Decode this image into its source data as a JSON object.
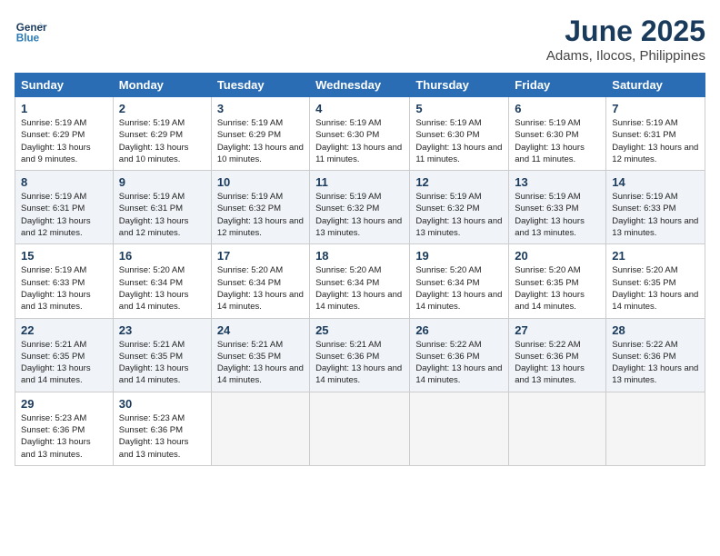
{
  "logo": {
    "line1": "General",
    "line2": "Blue"
  },
  "title": "June 2025",
  "subtitle": "Adams, Ilocos, Philippines",
  "weekdays": [
    "Sunday",
    "Monday",
    "Tuesday",
    "Wednesday",
    "Thursday",
    "Friday",
    "Saturday"
  ],
  "weeks": [
    [
      {
        "day": "1",
        "sunrise": "5:19 AM",
        "sunset": "6:29 PM",
        "daylight": "13 hours and 9 minutes."
      },
      {
        "day": "2",
        "sunrise": "5:19 AM",
        "sunset": "6:29 PM",
        "daylight": "13 hours and 10 minutes."
      },
      {
        "day": "3",
        "sunrise": "5:19 AM",
        "sunset": "6:29 PM",
        "daylight": "13 hours and 10 minutes."
      },
      {
        "day": "4",
        "sunrise": "5:19 AM",
        "sunset": "6:30 PM",
        "daylight": "13 hours and 11 minutes."
      },
      {
        "day": "5",
        "sunrise": "5:19 AM",
        "sunset": "6:30 PM",
        "daylight": "13 hours and 11 minutes."
      },
      {
        "day": "6",
        "sunrise": "5:19 AM",
        "sunset": "6:30 PM",
        "daylight": "13 hours and 11 minutes."
      },
      {
        "day": "7",
        "sunrise": "5:19 AM",
        "sunset": "6:31 PM",
        "daylight": "13 hours and 12 minutes."
      }
    ],
    [
      {
        "day": "8",
        "sunrise": "5:19 AM",
        "sunset": "6:31 PM",
        "daylight": "13 hours and 12 minutes."
      },
      {
        "day": "9",
        "sunrise": "5:19 AM",
        "sunset": "6:31 PM",
        "daylight": "13 hours and 12 minutes."
      },
      {
        "day": "10",
        "sunrise": "5:19 AM",
        "sunset": "6:32 PM",
        "daylight": "13 hours and 12 minutes."
      },
      {
        "day": "11",
        "sunrise": "5:19 AM",
        "sunset": "6:32 PM",
        "daylight": "13 hours and 13 minutes."
      },
      {
        "day": "12",
        "sunrise": "5:19 AM",
        "sunset": "6:32 PM",
        "daylight": "13 hours and 13 minutes."
      },
      {
        "day": "13",
        "sunrise": "5:19 AM",
        "sunset": "6:33 PM",
        "daylight": "13 hours and 13 minutes."
      },
      {
        "day": "14",
        "sunrise": "5:19 AM",
        "sunset": "6:33 PM",
        "daylight": "13 hours and 13 minutes."
      }
    ],
    [
      {
        "day": "15",
        "sunrise": "5:19 AM",
        "sunset": "6:33 PM",
        "daylight": "13 hours and 13 minutes."
      },
      {
        "day": "16",
        "sunrise": "5:20 AM",
        "sunset": "6:34 PM",
        "daylight": "13 hours and 14 minutes."
      },
      {
        "day": "17",
        "sunrise": "5:20 AM",
        "sunset": "6:34 PM",
        "daylight": "13 hours and 14 minutes."
      },
      {
        "day": "18",
        "sunrise": "5:20 AM",
        "sunset": "6:34 PM",
        "daylight": "13 hours and 14 minutes."
      },
      {
        "day": "19",
        "sunrise": "5:20 AM",
        "sunset": "6:34 PM",
        "daylight": "13 hours and 14 minutes."
      },
      {
        "day": "20",
        "sunrise": "5:20 AM",
        "sunset": "6:35 PM",
        "daylight": "13 hours and 14 minutes."
      },
      {
        "day": "21",
        "sunrise": "5:20 AM",
        "sunset": "6:35 PM",
        "daylight": "13 hours and 14 minutes."
      }
    ],
    [
      {
        "day": "22",
        "sunrise": "5:21 AM",
        "sunset": "6:35 PM",
        "daylight": "13 hours and 14 minutes."
      },
      {
        "day": "23",
        "sunrise": "5:21 AM",
        "sunset": "6:35 PM",
        "daylight": "13 hours and 14 minutes."
      },
      {
        "day": "24",
        "sunrise": "5:21 AM",
        "sunset": "6:35 PM",
        "daylight": "13 hours and 14 minutes."
      },
      {
        "day": "25",
        "sunrise": "5:21 AM",
        "sunset": "6:36 PM",
        "daylight": "13 hours and 14 minutes."
      },
      {
        "day": "26",
        "sunrise": "5:22 AM",
        "sunset": "6:36 PM",
        "daylight": "13 hours and 14 minutes."
      },
      {
        "day": "27",
        "sunrise": "5:22 AM",
        "sunset": "6:36 PM",
        "daylight": "13 hours and 13 minutes."
      },
      {
        "day": "28",
        "sunrise": "5:22 AM",
        "sunset": "6:36 PM",
        "daylight": "13 hours and 13 minutes."
      }
    ],
    [
      {
        "day": "29",
        "sunrise": "5:23 AM",
        "sunset": "6:36 PM",
        "daylight": "13 hours and 13 minutes."
      },
      {
        "day": "30",
        "sunrise": "5:23 AM",
        "sunset": "6:36 PM",
        "daylight": "13 hours and 13 minutes."
      },
      null,
      null,
      null,
      null,
      null
    ]
  ]
}
